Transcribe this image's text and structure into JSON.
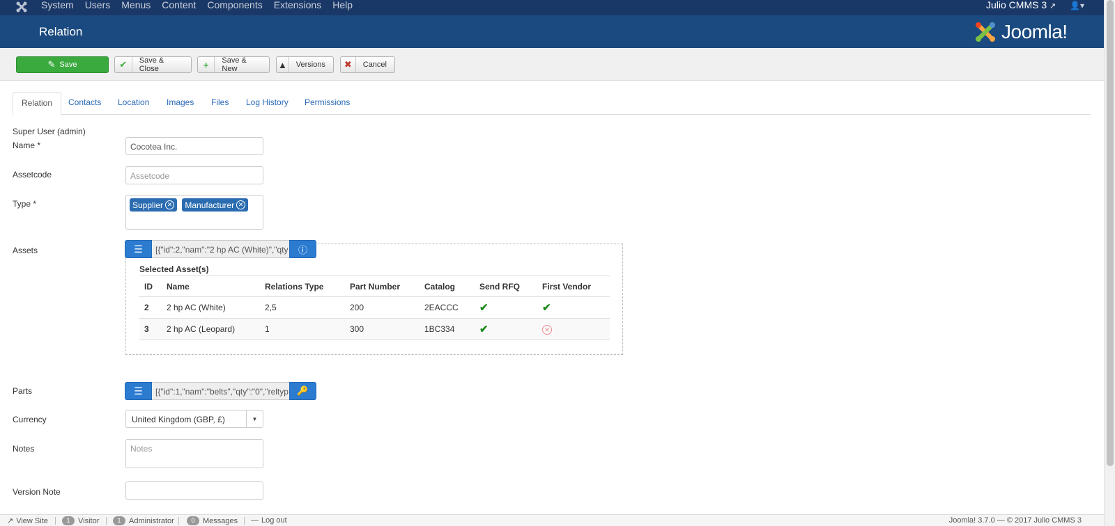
{
  "topnav": {
    "menu": [
      "System",
      "Users",
      "Menus",
      "Content",
      "Components",
      "Extensions",
      "Help"
    ],
    "site_name": "Julio CMMS 3",
    "user_icon": "user-icon"
  },
  "header": {
    "title": "Relation",
    "brand": "Joomla!"
  },
  "toolbar": {
    "save": "Save",
    "save_close": "Save & Close",
    "save_new": "Save & New",
    "versions": "Versions",
    "cancel": "Cancel"
  },
  "tabs": [
    "Relation",
    "Contacts",
    "Location",
    "Images",
    "Files",
    "Log History",
    "Permissions"
  ],
  "form": {
    "owner": "Super User (admin)",
    "name_label": "Name *",
    "name_value": "Cocotea Inc.",
    "assetcode_label": "Assetcode",
    "assetcode_placeholder": "Assetcode",
    "type_label": "Type *",
    "types": [
      "Supplier",
      "Manufacturer"
    ],
    "assets_label": "Assets",
    "assets_value": "[{\"id\":2,\"nam\":\"2 hp AC (White)\",\"qty",
    "selected_caption": "Selected Asset(s)",
    "columns": [
      "ID",
      "Name",
      "Relations Type",
      "Part Number",
      "Catalog",
      "Send RFQ",
      "First Vendor"
    ],
    "rows": [
      {
        "id": "2",
        "name": "2 hp AC (White)",
        "relations_type": "2,5",
        "part_number": "200",
        "catalog": "2EACCC",
        "send_rfq": true,
        "first_vendor": true
      },
      {
        "id": "3",
        "name": "2 hp AC (Leopard)",
        "relations_type": "1",
        "part_number": "300",
        "catalog": "1BC334",
        "send_rfq": true,
        "first_vendor": false
      }
    ],
    "parts_label": "Parts",
    "parts_value": "[{\"id\":1,\"nam\":\"belts\",\"qty\":\"0\",\"reltyp",
    "currency_label": "Currency",
    "currency_value": "United Kingdom (GBP, £)",
    "notes_label": "Notes",
    "notes_placeholder": "Notes",
    "version_note_label": "Version Note",
    "version_note_value": ""
  },
  "status": {
    "view_site": "View Site",
    "visitor_count": "1",
    "visitor": "Visitor",
    "admin_count": "1",
    "admin": "Administrator",
    "messages_count": "0",
    "messages": "Messages",
    "logout": "Log out",
    "footer": "Joomla! 3.7.0  —  © 2017 Julio CMMS 3"
  },
  "colors": {
    "topnav": "#1a3867",
    "header": "#1b4a80",
    "save": "#3aaa3e",
    "link": "#2a69b8",
    "chip": "#2b6cb0"
  }
}
